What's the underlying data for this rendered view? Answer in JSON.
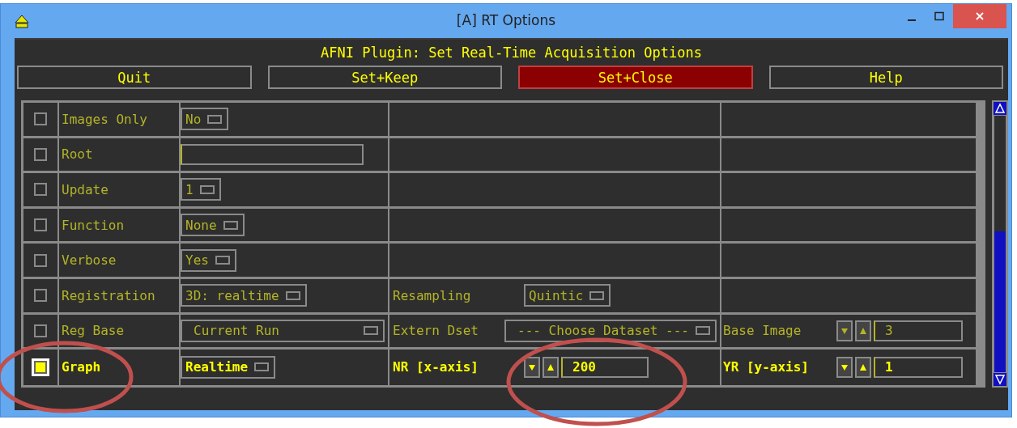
{
  "window": {
    "title": "[A] RT Options"
  },
  "header": "AFNI Plugin: Set Real-Time Acquisition Options",
  "buttons": [
    {
      "label": "Quit",
      "selected": false
    },
    {
      "label": "Set+Keep",
      "selected": false
    },
    {
      "label": "Set+Close",
      "selected": true
    },
    {
      "label": "Help",
      "selected": false
    }
  ],
  "rows": [
    {
      "checked": false,
      "enabled": false,
      "label": "Images Only",
      "control": {
        "kind": "menu",
        "value": "No"
      }
    },
    {
      "checked": false,
      "enabled": false,
      "label": "Root",
      "control": {
        "kind": "text"
      }
    },
    {
      "checked": false,
      "enabled": false,
      "label": "Update",
      "control": {
        "kind": "menu",
        "value": "1"
      }
    },
    {
      "checked": false,
      "enabled": false,
      "label": "Function",
      "control": {
        "kind": "menu",
        "value": "None"
      }
    },
    {
      "checked": false,
      "enabled": false,
      "label": "Verbose",
      "control": {
        "kind": "menu",
        "value": "Yes"
      }
    },
    {
      "checked": false,
      "enabled": false,
      "label": "Registration",
      "control": {
        "kind": "menu",
        "value": "3D: realtime"
      },
      "extra": [
        {
          "label": "Resampling",
          "control": {
            "kind": "menu",
            "value": "Quintic"
          }
        }
      ]
    },
    {
      "checked": false,
      "enabled": false,
      "label": "Reg Base",
      "control": {
        "kind": "wide-menu",
        "value": "Current Run"
      },
      "extra": [
        {
          "label": "Extern Dset",
          "control": {
            "kind": "wide-menu",
            "value": "--- Choose Dataset ---"
          }
        },
        {
          "label": "Base Image",
          "control": {
            "kind": "spinner",
            "value": "3"
          }
        }
      ]
    },
    {
      "checked": true,
      "enabled": true,
      "label": "Graph",
      "control": {
        "kind": "menu",
        "value": "Realtime"
      },
      "extra": [
        {
          "label": "NR [x-axis]",
          "control": {
            "kind": "spinner",
            "value": "200"
          }
        },
        {
          "label": "YR [y-axis]",
          "control": {
            "kind": "spinner",
            "value": "1"
          }
        }
      ]
    }
  ]
}
